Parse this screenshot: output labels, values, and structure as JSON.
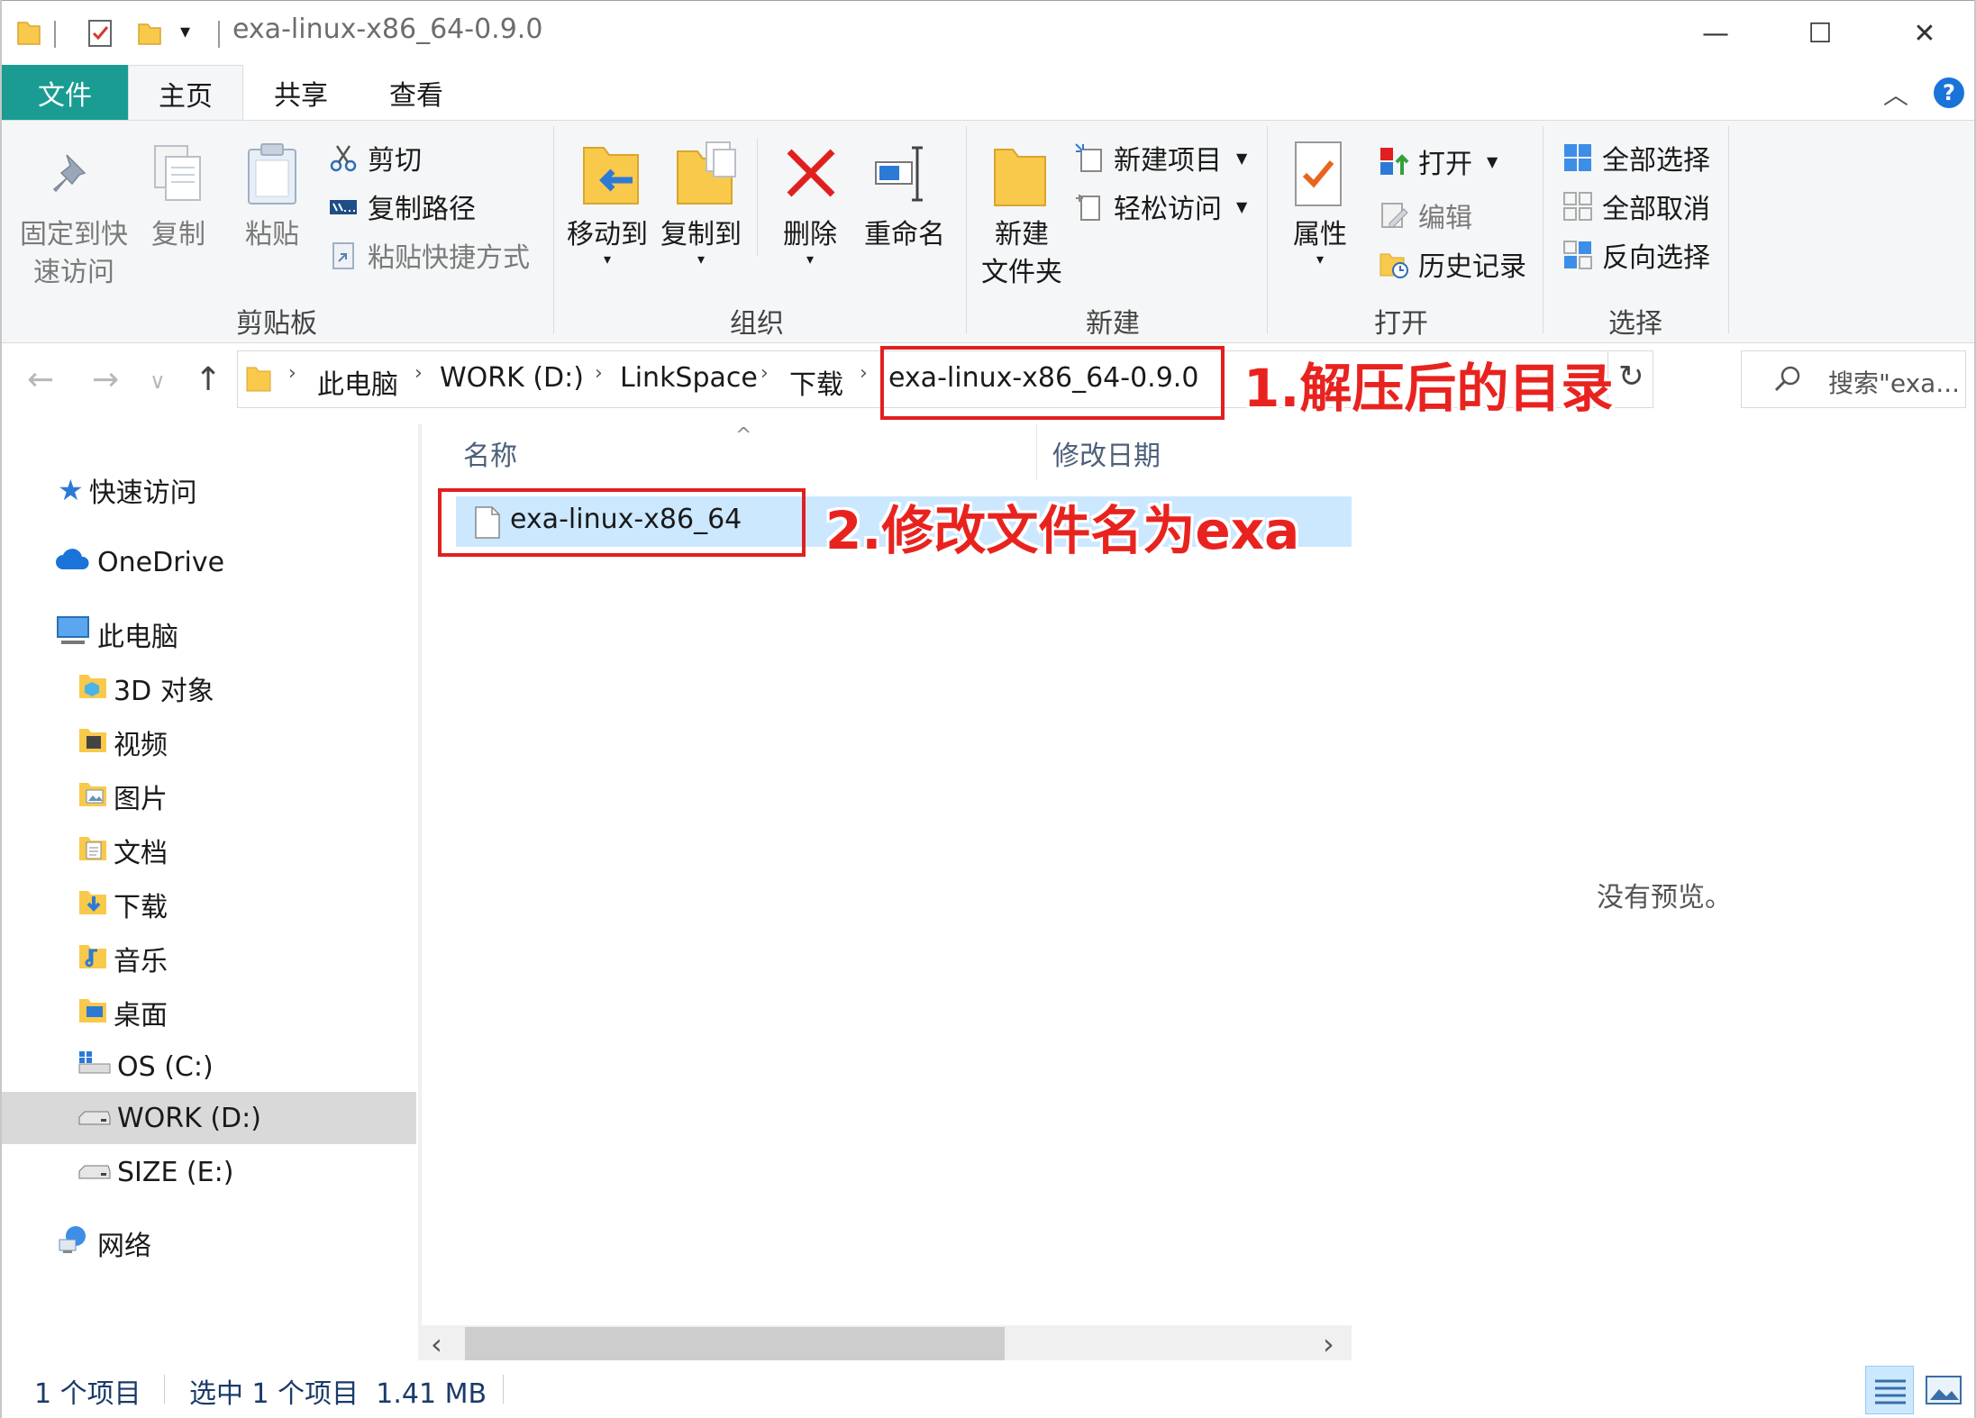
{
  "window": {
    "title": "exa-linux-x86_64-0.9.0",
    "minimize_glyph": "—",
    "maximize_glyph": "☐",
    "close_glyph": "✕"
  },
  "tabs": {
    "file": "文件",
    "home": "主页",
    "share": "共享",
    "view": "查看",
    "collapse_glyph": "︿",
    "help_glyph": "?"
  },
  "ribbon": {
    "clipboard": {
      "group_label": "剪贴板",
      "pin_line1": "固定到快",
      "pin_line2": "速访问",
      "copy": "复制",
      "paste": "粘贴",
      "cut": "剪切",
      "copy_path": "复制路径",
      "paste_shortcut": "粘贴快捷方式"
    },
    "organize": {
      "group_label": "组织",
      "move_to": "移动到",
      "copy_to": "复制到",
      "delete": "删除",
      "rename": "重命名"
    },
    "new": {
      "group_label": "新建",
      "new_folder_line1": "新建",
      "new_folder_line2": "文件夹",
      "new_item": "新建项目",
      "easy_access": "轻松访问"
    },
    "open": {
      "group_label": "打开",
      "properties": "属性",
      "open": "打开",
      "edit": "编辑",
      "history": "历史记录"
    },
    "select": {
      "group_label": "选择",
      "select_all": "全部选择",
      "select_none": "全部取消",
      "invert": "反向选择"
    }
  },
  "address": {
    "back_glyph": "←",
    "forward_glyph": "→",
    "recent_glyph": "∨",
    "up_glyph": "↑",
    "crumbs": [
      "此电脑",
      "WORK (D:)",
      "LinkSpace",
      "下载",
      "exa-linux-x86_64-0.9.0"
    ],
    "separator": "›",
    "refresh_glyph": "↻",
    "search_placeholder": "搜索\"exa..."
  },
  "nav": {
    "quick_access": "快速访问",
    "onedrive": "OneDrive",
    "this_pc": "此电脑",
    "objects3d": "3D 对象",
    "videos": "视频",
    "pictures": "图片",
    "documents": "文档",
    "downloads": "下载",
    "music": "音乐",
    "desktop": "桌面",
    "drive_c": "OS (C:)",
    "drive_d": "WORK (D:)",
    "drive_e": "SIZE (E:)",
    "network": "网络"
  },
  "filelist": {
    "col_name": "名称",
    "col_date": "修改日期",
    "sort_glyph": "^",
    "files": [
      {
        "name": "exa-linux-x86_64"
      }
    ],
    "scroll_left_glyph": "‹",
    "scroll_right_glyph": "›",
    "scroll_thumb_fraction": 0.64
  },
  "preview": {
    "empty_text": "没有预览。"
  },
  "status": {
    "item_count": "1 个项目",
    "selection": "选中 1 个项目  1.41 MB"
  },
  "annotations": {
    "step1": "1.解压后的目录",
    "step2": "2.修改文件名为exa"
  },
  "colors": {
    "file_tab": "#1a9c93",
    "selection": "#cce8ff",
    "annotation": "#e8231f"
  }
}
